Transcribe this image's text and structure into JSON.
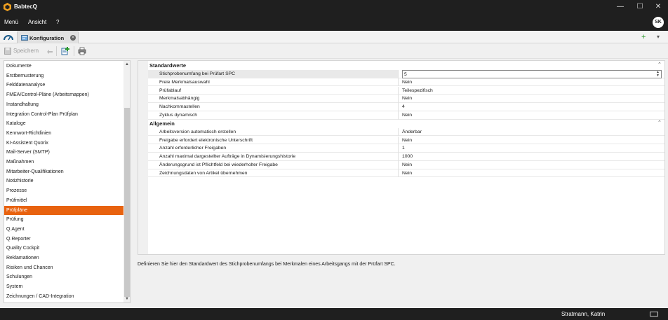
{
  "window": {
    "title": "BabtecQ",
    "controls": [
      "—",
      "☐",
      "✕"
    ]
  },
  "menu": {
    "items": [
      "Menü",
      "Ansicht",
      "?"
    ],
    "avatar": "SK"
  },
  "tabs": {
    "active_label": "Konfiguration",
    "close": "×",
    "add": "+",
    "more": "▾"
  },
  "toolbar": {
    "save_label": "Speichern"
  },
  "sidebar": {
    "selected": "Prüfpläne",
    "items": [
      "Dokumente",
      "Erstbemusterung",
      "Felddatenanalyse",
      "FMEA/Control-Pläne (Arbeitsmappen)",
      "Instandhaltung",
      "Integration Control-Plan Prüfplan",
      "Kataloge",
      "Kennwort-Richtlinien",
      "KI-Assistent Quorix",
      "Mail-Server (SMTP)",
      "Maßnahmen",
      "Mitarbeiter-Qualifikationen",
      "Notizhistorie",
      "Prozesse",
      "Prüfmittel",
      "Prüfpläne",
      "Prüfung",
      "Q.Agent",
      "Q.Reporter",
      "Quality Cockpit",
      "Reklamationen",
      "Risiken und Chancen",
      "Schulungen",
      "System",
      "Zeichnungen / CAD-Integration"
    ]
  },
  "properties": {
    "categories": [
      {
        "name": "Standardwerte",
        "rows": [
          {
            "label": "Stichprobenumfang bei Prüfart SPC",
            "value": "5"
          },
          {
            "label": "Freie Merkmalsauswahl",
            "value": "Nein"
          },
          {
            "label": "Prüfablauf",
            "value": "Teilespezifisch"
          },
          {
            "label": "Merkmalsabhängig",
            "value": "Nein"
          },
          {
            "label": "Nachkommastellen",
            "value": "4"
          },
          {
            "label": "Zyklus dynamisch",
            "value": "Nein"
          }
        ]
      },
      {
        "name": "Allgemein",
        "rows": [
          {
            "label": "Arbeitsversion automatisch erstellen",
            "value": "Änderbar"
          },
          {
            "label": "Freigabe erfordert elektronische Unterschrift",
            "value": "Nein"
          },
          {
            "label": "Anzahl erforderlicher Freigaben",
            "value": "1"
          },
          {
            "label": "Anzahl maximal dargestellter Aufträge in Dynamisierungshistorie",
            "value": "1000"
          },
          {
            "label": "Änderungsgrund ist Pflichtfeld bei wiederholter Freigabe",
            "value": "Nein"
          },
          {
            "label": "Zeichnungsdaten von Artikel übernehmen",
            "value": "Nein"
          }
        ]
      }
    ]
  },
  "description": "Definieren Sie hier den Standardwert des Stichprobenumfangs bei Merkmalen eines Arbeitsgangs mit der Prüfart SPC.",
  "status": {
    "user": "Stratmann, Katrin"
  },
  "colors": {
    "accent": "#e8620f",
    "chrome": "#1f1f1f"
  }
}
